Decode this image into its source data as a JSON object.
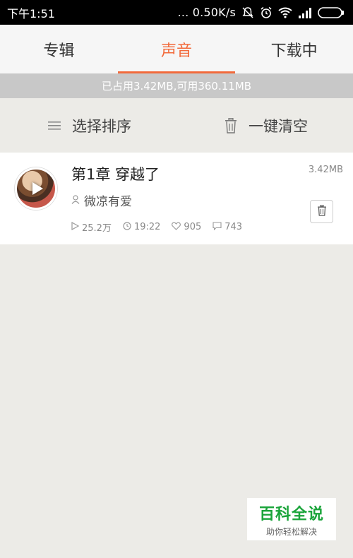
{
  "status_bar": {
    "time": "下午1:51",
    "network_speed": "... 0.50K/s",
    "icons": [
      "mute-bell-icon",
      "alarm-icon",
      "wifi-icon",
      "signal-icon",
      "battery-icon"
    ]
  },
  "tabs": [
    {
      "label": "专辑",
      "active": false
    },
    {
      "label": "声音",
      "active": true
    },
    {
      "label": "下载中",
      "active": false
    }
  ],
  "storage_info": "已占用3.42MB,可用360.11MB",
  "actions": {
    "sort_label": "选择排序",
    "clear_label": "一键清空"
  },
  "items": [
    {
      "title": "第1章 穿越了",
      "author": "微凉有爱",
      "size": "3.42MB",
      "plays": "25.2万",
      "duration": "19:22",
      "likes": "905",
      "comments": "743"
    }
  ],
  "watermark": {
    "title": "百科全说",
    "subtitle": "助你轻松解决"
  },
  "colors": {
    "accent": "#f26a3b",
    "watermark_green": "#1aa43a"
  }
}
